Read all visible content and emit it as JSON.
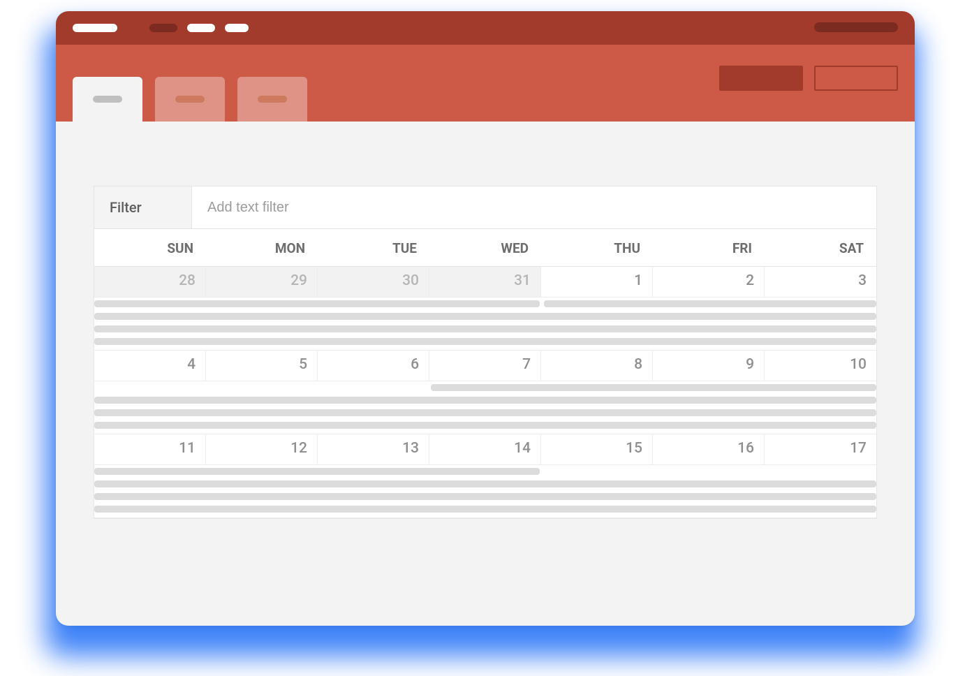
{
  "colors": {
    "titlebar": "#a33b2c",
    "tabbar": "#cd5a46",
    "shadow": "#1d6df7",
    "content_bg": "#f3f3f3",
    "event_bar": "#dcdcdc"
  },
  "filter": {
    "label": "Filter",
    "placeholder": "Add text filter"
  },
  "calendar": {
    "day_headers": [
      "SUN",
      "MON",
      "TUE",
      "WED",
      "THU",
      "FRI",
      "SAT"
    ],
    "weeks": [
      {
        "days": [
          {
            "num": "28",
            "other_month": true
          },
          {
            "num": "29",
            "other_month": true
          },
          {
            "num": "30",
            "other_month": true
          },
          {
            "num": "31",
            "other_month": true
          },
          {
            "num": "1",
            "other_month": false
          },
          {
            "num": "2",
            "other_month": false
          },
          {
            "num": "3",
            "other_month": false
          }
        ],
        "events": [
          {
            "start_pct": 0,
            "end_pct": 57,
            "row": 0
          },
          {
            "start_pct": 57.5,
            "end_pct": 100,
            "row": 0
          },
          {
            "start_pct": 0,
            "end_pct": 100,
            "row": 1
          },
          {
            "start_pct": 0,
            "end_pct": 100,
            "row": 2
          },
          {
            "start_pct": 0,
            "end_pct": 100,
            "row": 3
          }
        ]
      },
      {
        "days": [
          {
            "num": "4",
            "other_month": false
          },
          {
            "num": "5",
            "other_month": false
          },
          {
            "num": "6",
            "other_month": false
          },
          {
            "num": "7",
            "other_month": false
          },
          {
            "num": "8",
            "other_month": false
          },
          {
            "num": "9",
            "other_month": false
          },
          {
            "num": "10",
            "other_month": false
          }
        ],
        "events": [
          {
            "start_pct": 43,
            "end_pct": 100,
            "row": 0
          },
          {
            "start_pct": 0,
            "end_pct": 100,
            "row": 1
          },
          {
            "start_pct": 0,
            "end_pct": 100,
            "row": 2
          },
          {
            "start_pct": 0,
            "end_pct": 100,
            "row": 3
          }
        ]
      },
      {
        "days": [
          {
            "num": "11",
            "other_month": false
          },
          {
            "num": "12",
            "other_month": false
          },
          {
            "num": "13",
            "other_month": false
          },
          {
            "num": "14",
            "other_month": false
          },
          {
            "num": "15",
            "other_month": false
          },
          {
            "num": "16",
            "other_month": false
          },
          {
            "num": "17",
            "other_month": false
          }
        ],
        "events": [
          {
            "start_pct": 0,
            "end_pct": 57,
            "row": 0
          },
          {
            "start_pct": 0,
            "end_pct": 100,
            "row": 1
          },
          {
            "start_pct": 0,
            "end_pct": 100,
            "row": 2
          },
          {
            "start_pct": 0,
            "end_pct": 100,
            "row": 3
          }
        ]
      }
    ]
  }
}
